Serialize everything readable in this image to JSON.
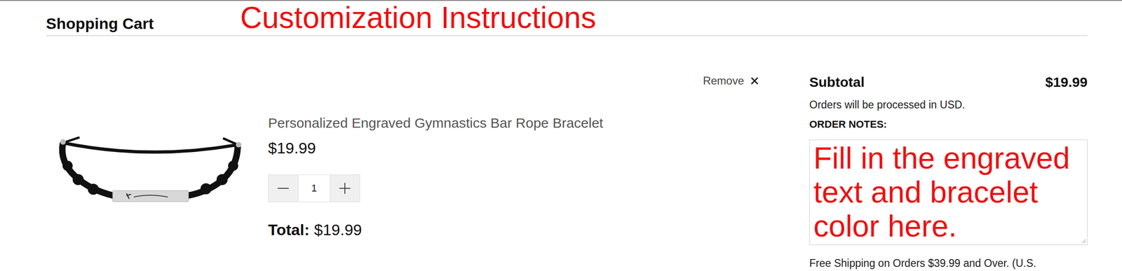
{
  "header": {
    "title": "Shopping Cart",
    "annotation": "Customization Instructions"
  },
  "cart_item": {
    "remove": "Remove",
    "name": "Personalized Engraved Gymnastics Bar Rope Bracelet",
    "price": "$19.99",
    "quantity": "1",
    "total_label": "Total:",
    "total": "$19.99"
  },
  "summary": {
    "subtotal_label": "Subtotal",
    "subtotal": "$19.99",
    "currency_note": "Orders will be processed in USD.",
    "notes_label": "ORDER NOTES:",
    "notes_annotation": "Fill in the engraved text and bracelet color here.",
    "shipping_note": "Free Shipping on Orders $39.99 and Over. (U.S."
  }
}
